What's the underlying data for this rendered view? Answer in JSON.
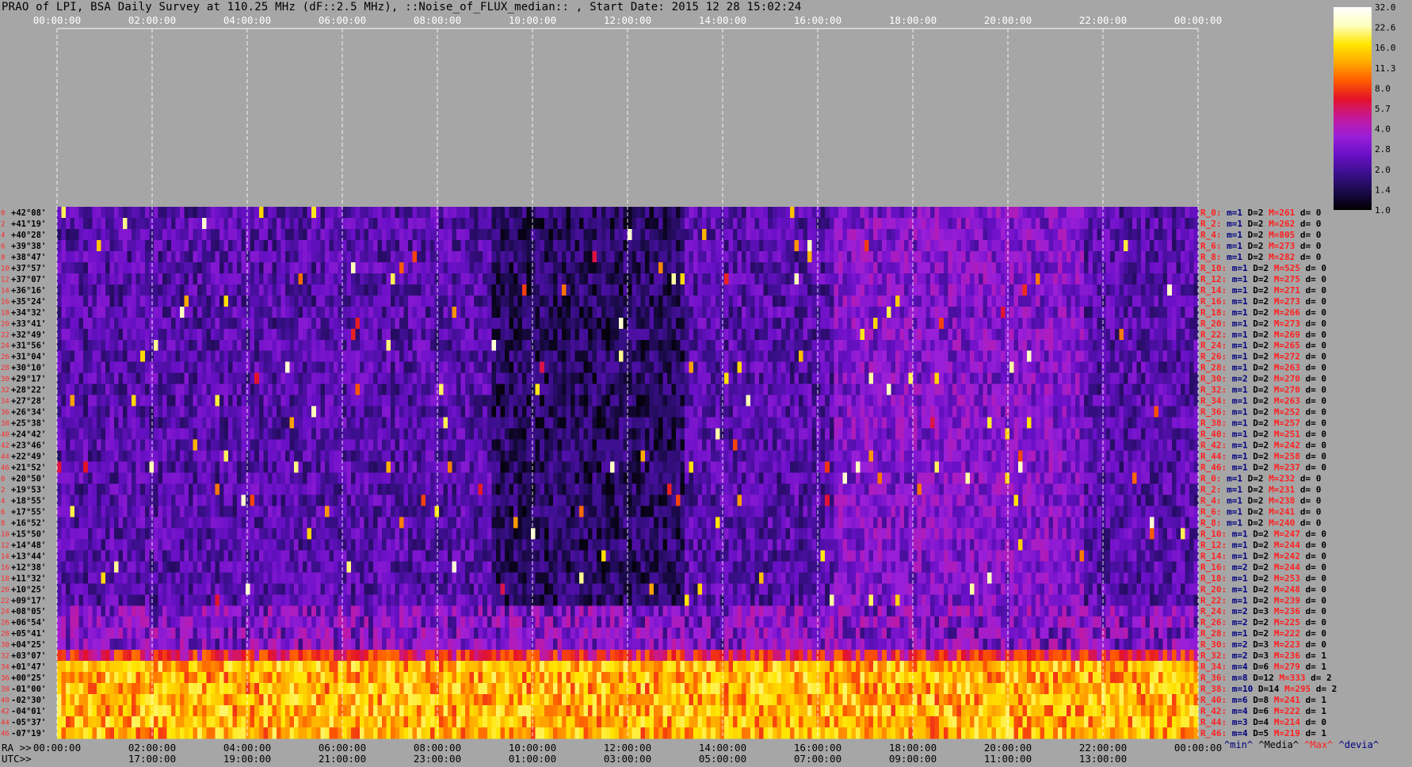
{
  "title": "PRAO of LPI, BSA Daily Survey at 110.25 MHz (dF::2.5 MHz), ::Noise_of_FLUX_median:: , Start Date: 2015 12 28 15:02:24",
  "chart_data": {
    "type": "heatmap",
    "title": "PRAO of LPI, BSA Daily Survey at 110.25 MHz (dF::2.5 MHz), ::Noise_of_FLUX_median:: , Start Date: 2015 12 28 15:02:24",
    "x_top_ticks": [
      "00:00:00",
      "02:00:00",
      "04:00:00",
      "06:00:00",
      "08:00:00",
      "10:00:00",
      "12:00:00",
      "14:00:00",
      "16:00:00",
      "18:00:00",
      "20:00:00",
      "22:00:00",
      "00:00:00"
    ],
    "x_bottom_ra_label": "RA >>",
    "x_bottom_ra_ticks": [
      "00:00:00",
      "02:00:00",
      "04:00:00",
      "06:00:00",
      "08:00:00",
      "10:00:00",
      "12:00:00",
      "14:00:00",
      "16:00:00",
      "18:00:00",
      "20:00:00",
      "22:00:00",
      "00:00:00"
    ],
    "x_bottom_utc_label": "UTC>>",
    "x_bottom_utc_ticks": [
      "17:00:00",
      "19:00:00",
      "21:00:00",
      "23:00:00",
      "01:00:00",
      "03:00:00",
      "05:00:00",
      "07:00:00",
      "09:00:00",
      "11:00:00",
      "13:00:00"
    ],
    "y_labels": [
      "+42°08'",
      "+41°19'",
      "+40°28'",
      "+39°38'",
      "+38°47'",
      "+37°57'",
      "+37°07'",
      "+36°16'",
      "+35°24'",
      "+34°32'",
      "+33°41'",
      "+32°49'",
      "+31°56'",
      "+31°04'",
      "+30°10'",
      "+29°17'",
      "+28°22'",
      "+27°28'",
      "+26°34'",
      "+25°38'",
      "+24°42'",
      "+23°46'",
      "+22°49'",
      "+21°52'",
      "+20°50'",
      "+19°53'",
      "+18°55'",
      "+17°55'",
      "+16°52'",
      "+15°50'",
      "+14°48'",
      "+13°44'",
      "+12°38'",
      "+11°32'",
      "+10°25'",
      "+09°17'",
      "+08°05'",
      "+06°54'",
      "+05°41'",
      "+04°25'",
      "+03°07'",
      "+01°47'",
      "+00°25'",
      "-01°00'",
      "-02°30'",
      "-04°01'",
      "-05°37'",
      "-07°19'"
    ],
    "row_indices": [
      "0",
      "2",
      "4",
      "6",
      "8",
      "10",
      "12",
      "14",
      "16",
      "18",
      "20",
      "22",
      "24",
      "26",
      "28",
      "30",
      "32",
      "34",
      "36",
      "38",
      "40",
      "42",
      "44",
      "46",
      "0",
      "2",
      "4",
      "6",
      "8",
      "10",
      "12",
      "14",
      "16",
      "18",
      "20",
      "22",
      "24",
      "26",
      "28",
      "30",
      "32",
      "34",
      "36",
      "38",
      "40",
      "42",
      "44",
      "46"
    ],
    "row_stats": [
      {
        "r": "R_0:",
        "m": "m=1",
        "D": "D=2",
        "M": "M=261",
        "d": "d= 0"
      },
      {
        "r": "R_2:",
        "m": "m=1",
        "D": "D=2",
        "M": "M=262",
        "d": "d= 0"
      },
      {
        "r": "R_4:",
        "m": "m=1",
        "D": "D=2",
        "M": "M=805",
        "d": "d= 0"
      },
      {
        "r": "R_6:",
        "m": "m=1",
        "D": "D=2",
        "M": "M=273",
        "d": "d= 0"
      },
      {
        "r": "R_8:",
        "m": "m=1",
        "D": "D=2",
        "M": "M=282",
        "d": "d= 0"
      },
      {
        "r": "R_10:",
        "m": "m=1",
        "D": "D=2",
        "M": "M=525",
        "d": "d= 0"
      },
      {
        "r": "R_12:",
        "m": "m=1",
        "D": "D=2",
        "M": "M=275",
        "d": "d= 0"
      },
      {
        "r": "R_14:",
        "m": "m=1",
        "D": "D=2",
        "M": "M=271",
        "d": "d= 0"
      },
      {
        "r": "R_16:",
        "m": "m=1",
        "D": "D=2",
        "M": "M=273",
        "d": "d= 0"
      },
      {
        "r": "R_18:",
        "m": "m=1",
        "D": "D=2",
        "M": "M=266",
        "d": "d= 0"
      },
      {
        "r": "R_20:",
        "m": "m=1",
        "D": "D=2",
        "M": "M=273",
        "d": "d= 0"
      },
      {
        "r": "R_22:",
        "m": "m=1",
        "D": "D=2",
        "M": "M=269",
        "d": "d= 0"
      },
      {
        "r": "R_24:",
        "m": "m=1",
        "D": "D=2",
        "M": "M=265",
        "d": "d= 0"
      },
      {
        "r": "R_26:",
        "m": "m=1",
        "D": "D=2",
        "M": "M=272",
        "d": "d= 0"
      },
      {
        "r": "R_28:",
        "m": "m=1",
        "D": "D=2",
        "M": "M=263",
        "d": "d= 0"
      },
      {
        "r": "R_30:",
        "m": "m=2",
        "D": "D=2",
        "M": "M=270",
        "d": "d= 0"
      },
      {
        "r": "R_32:",
        "m": "m=1",
        "D": "D=2",
        "M": "M=270",
        "d": "d= 0"
      },
      {
        "r": "R_34:",
        "m": "m=1",
        "D": "D=2",
        "M": "M=263",
        "d": "d= 0"
      },
      {
        "r": "R_36:",
        "m": "m=1",
        "D": "D=2",
        "M": "M=252",
        "d": "d= 0"
      },
      {
        "r": "R_38:",
        "m": "m=1",
        "D": "D=2",
        "M": "M=257",
        "d": "d= 0"
      },
      {
        "r": "R_40:",
        "m": "m=1",
        "D": "D=2",
        "M": "M=251",
        "d": "d= 0"
      },
      {
        "r": "R_42:",
        "m": "m=1",
        "D": "D=2",
        "M": "M=242",
        "d": "d= 0"
      },
      {
        "r": "R_44:",
        "m": "m=1",
        "D": "D=2",
        "M": "M=258",
        "d": "d= 0"
      },
      {
        "r": "R_46:",
        "m": "m=1",
        "D": "D=2",
        "M": "M=237",
        "d": "d= 0"
      },
      {
        "r": "R_0:",
        "m": "m=1",
        "D": "D=2",
        "M": "M=232",
        "d": "d= 0"
      },
      {
        "r": "R_2:",
        "m": "m=1",
        "D": "D=2",
        "M": "M=231",
        "d": "d= 0"
      },
      {
        "r": "R_4:",
        "m": "m=1",
        "D": "D=2",
        "M": "M=238",
        "d": "d= 0"
      },
      {
        "r": "R_6:",
        "m": "m=1",
        "D": "D=2",
        "M": "M=241",
        "d": "d= 0"
      },
      {
        "r": "R_8:",
        "m": "m=1",
        "D": "D=2",
        "M": "M=240",
        "d": "d= 0"
      },
      {
        "r": "R_10:",
        "m": "m=1",
        "D": "D=2",
        "M": "M=247",
        "d": "d= 0"
      },
      {
        "r": "R_12:",
        "m": "m=1",
        "D": "D=2",
        "M": "M=244",
        "d": "d= 0"
      },
      {
        "r": "R_14:",
        "m": "m=1",
        "D": "D=2",
        "M": "M=242",
        "d": "d= 0"
      },
      {
        "r": "R_16:",
        "m": "m=2",
        "D": "D=2",
        "M": "M=244",
        "d": "d= 0"
      },
      {
        "r": "R_18:",
        "m": "m=1",
        "D": "D=2",
        "M": "M=253",
        "d": "d= 0"
      },
      {
        "r": "R_20:",
        "m": "m=1",
        "D": "D=2",
        "M": "M=248",
        "d": "d= 0"
      },
      {
        "r": "R_22:",
        "m": "m=1",
        "D": "D=2",
        "M": "M=239",
        "d": "d= 0"
      },
      {
        "r": "R_24:",
        "m": "m=2",
        "D": "D=3",
        "M": "M=236",
        "d": "d= 0"
      },
      {
        "r": "R_26:",
        "m": "m=2",
        "D": "D=2",
        "M": "M=225",
        "d": "d= 0"
      },
      {
        "r": "R_28:",
        "m": "m=1",
        "D": "D=2",
        "M": "M=222",
        "d": "d= 0"
      },
      {
        "r": "R_30:",
        "m": "m=2",
        "D": "D=3",
        "M": "M=223",
        "d": "d= 0"
      },
      {
        "r": "R_32:",
        "m": "m=2",
        "D": "D=3",
        "M": "M=236",
        "d": "d= 1"
      },
      {
        "r": "R_34:",
        "m": "m=4",
        "D": "D=6",
        "M": "M=279",
        "d": "d= 1"
      },
      {
        "r": "R_36:",
        "m": "m=8",
        "D": "D=12",
        "M": "M=333",
        "d": "d= 2"
      },
      {
        "r": "R_38:",
        "m": "m=10",
        "D": "D=14",
        "M": "M=295",
        "d": "d= 2"
      },
      {
        "r": "R_40:",
        "m": "m=6",
        "D": "D=8",
        "M": "M=241",
        "d": "d= 1"
      },
      {
        "r": "R_42:",
        "m": "m=4",
        "D": "D=6",
        "M": "M=222",
        "d": "d= 1"
      },
      {
        "r": "R_44:",
        "m": "m=3",
        "D": "D=4",
        "M": "M=214",
        "d": "d= 0"
      },
      {
        "r": "R_46:",
        "m": "m=4",
        "D": "D=5",
        "M": "M=219",
        "d": "d= 1"
      }
    ],
    "stat_legend": [
      "^min^",
      "^Media^",
      "^Max^",
      "^devia^"
    ],
    "colorbar_ticks": [
      "32.0",
      "22.6",
      "16.0",
      "11.3",
      "8.0",
      "5.7",
      "4.0",
      "2.8",
      "2.0",
      "1.4",
      "1.0"
    ],
    "colorbar_scale": "log2",
    "colorbar_range": [
      1.0,
      32.0
    ],
    "colormap": [
      "#000000",
      "#1a0a4a",
      "#3b0f8c",
      "#6a10c8",
      "#9b1fd8",
      "#c4189a",
      "#e3122a",
      "#ff5a00",
      "#ffaa00",
      "#ffe600",
      "#ffffc0",
      "#ffffff"
    ],
    "grid": true,
    "bands": [
      {
        "rows": [
          41,
          47
        ],
        "level": 14.0
      },
      {
        "rows": [
          40,
          40
        ],
        "level": 7.0
      },
      {
        "rows": [
          36,
          39
        ],
        "level": 3.2
      }
    ],
    "colors": {
      "stat_r": "#ff2020",
      "stat_m": "#000080",
      "stat_D": "#000000",
      "stat_M": "#ff2020",
      "stat_d": "#000000",
      "legend_min": "#000080",
      "legend_media": "#000000",
      "legend_max": "#ff2020",
      "legend_devia": "#000080"
    }
  }
}
